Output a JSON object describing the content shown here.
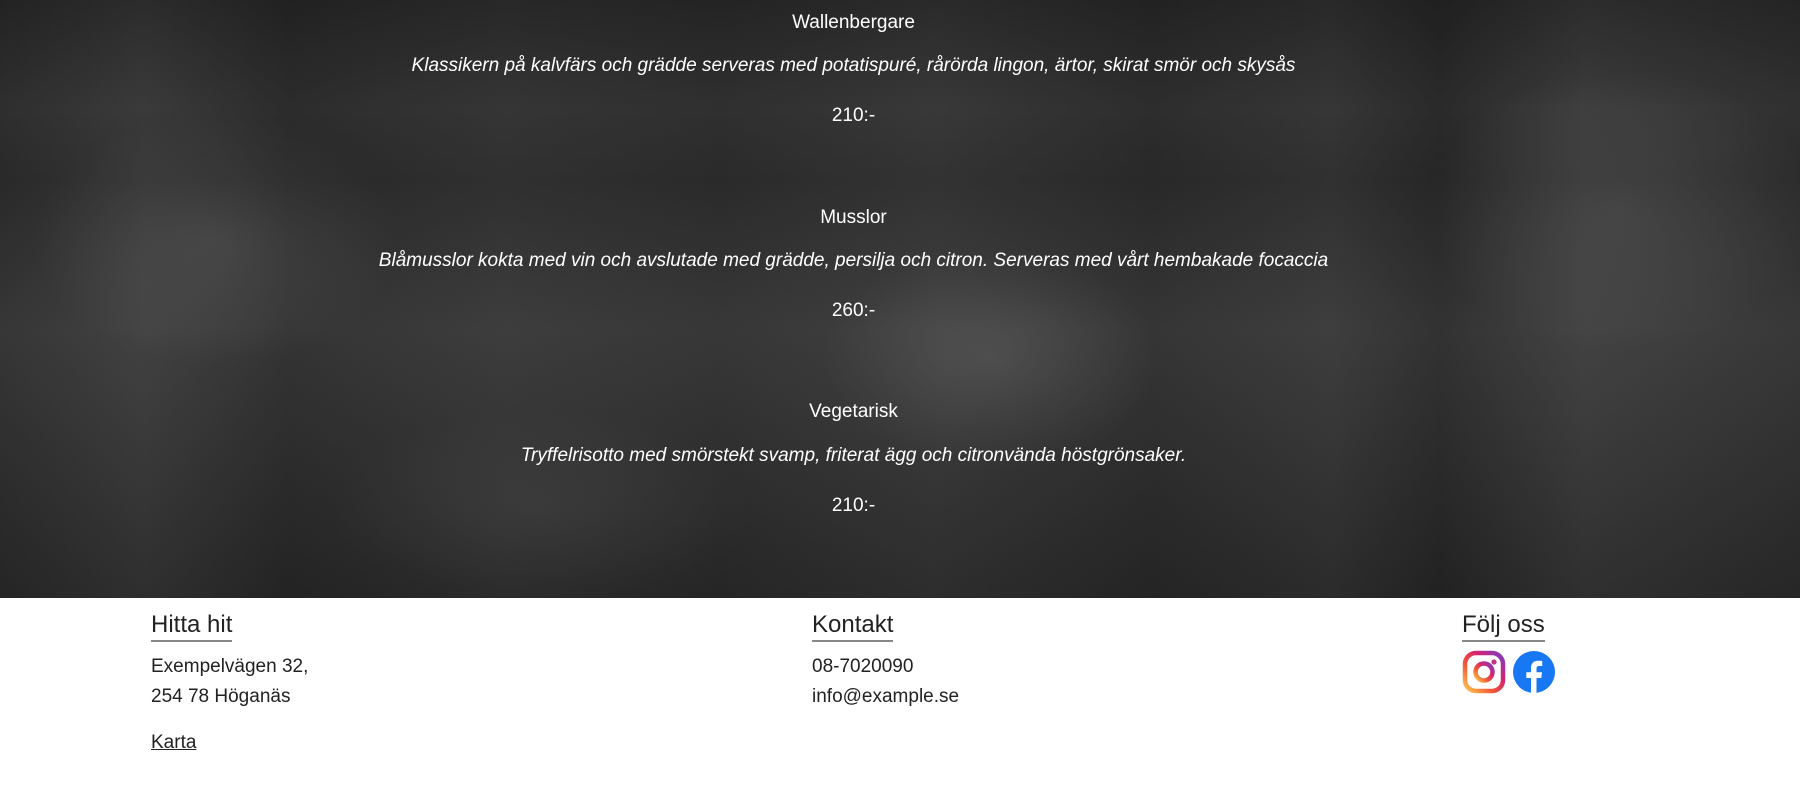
{
  "menu": {
    "dishes": [
      {
        "name": "Wallenbergare",
        "description": "Klassikern på kalvfärs och grädde serveras med potatispuré, rårörda lingon, ärtor, skirat smör och skysås",
        "price": "210:-"
      },
      {
        "name": "Musslor",
        "description": "Blåmusslor kokta med vin och avslutade med grädde, persilja och citron. Serveras med vårt hembakade focaccia",
        "price": "260:-"
      },
      {
        "name": "Vegetarisk",
        "description": "Tryffelrisotto med smörstekt svamp, friterat ägg och citronvända höstgrönsaker.",
        "price": "210:-"
      }
    ]
  },
  "footer": {
    "find_us": {
      "title": "Hitta hit",
      "address_line1": "Exempelvägen 32,",
      "address_line2": "254 78 Höganäs",
      "map_link": "Karta"
    },
    "contact": {
      "title": "Kontakt",
      "phone": "08-7020090",
      "email": "info@example.se"
    },
    "follow": {
      "title": "Följ oss",
      "icons": [
        "instagram-icon",
        "facebook-icon"
      ]
    }
  },
  "colors": {
    "menu_text": "#ffffff",
    "footer_text": "#222222",
    "facebook_blue": "#1877f2"
  }
}
